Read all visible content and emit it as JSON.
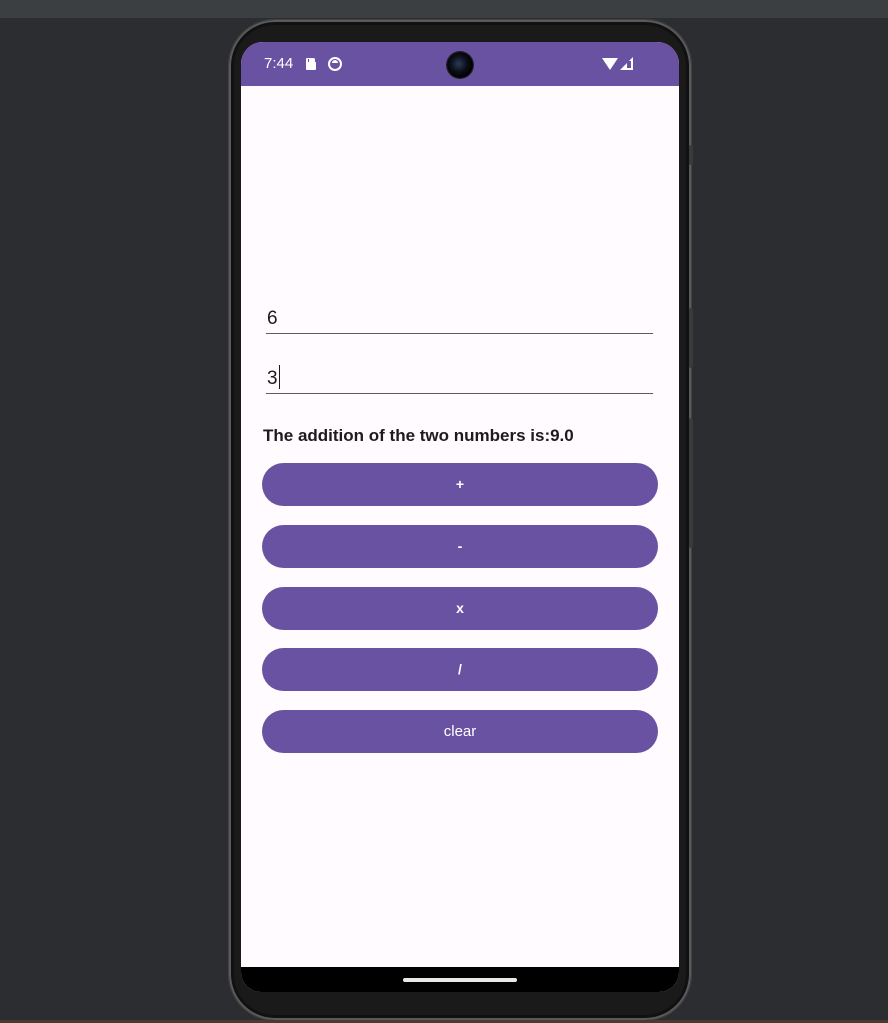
{
  "status_bar": {
    "time": "7:44",
    "icons": [
      "sd-card-icon",
      "sync-icon",
      "camera-cutout",
      "wifi-icon",
      "signal-icon"
    ]
  },
  "inputs": {
    "first_value": "6",
    "second_value": "3"
  },
  "result": {
    "text": "The addition of the two numbers is:9.0"
  },
  "buttons": {
    "add": "+",
    "subtract": "-",
    "multiply": "x",
    "divide": "/",
    "clear": "clear"
  },
  "colors": {
    "primary": "#6a52a3",
    "background": "#fffbfe",
    "on_primary": "#ffffff",
    "text": "#1c1b1f"
  }
}
